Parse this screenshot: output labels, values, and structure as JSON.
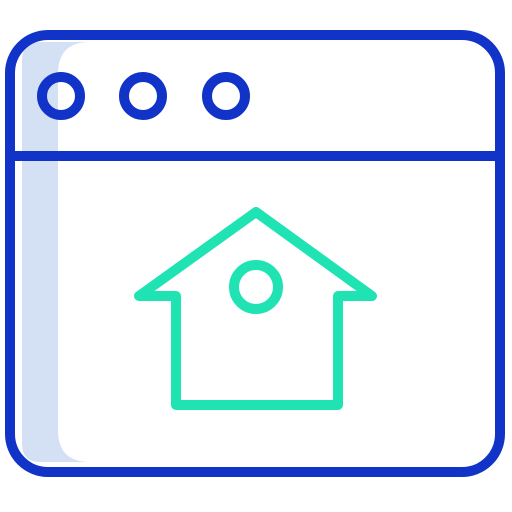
{
  "icon": {
    "name": "browser-home-icon",
    "window_buttons": [
      "window-dot-icon",
      "window-dot-icon",
      "window-dot-icon"
    ],
    "content_icon": "home-icon"
  },
  "colors": {
    "frame": "#1133c7",
    "accent": "#1fe3b3",
    "shadow": "#d4e1f4",
    "background": "#ffffff"
  }
}
